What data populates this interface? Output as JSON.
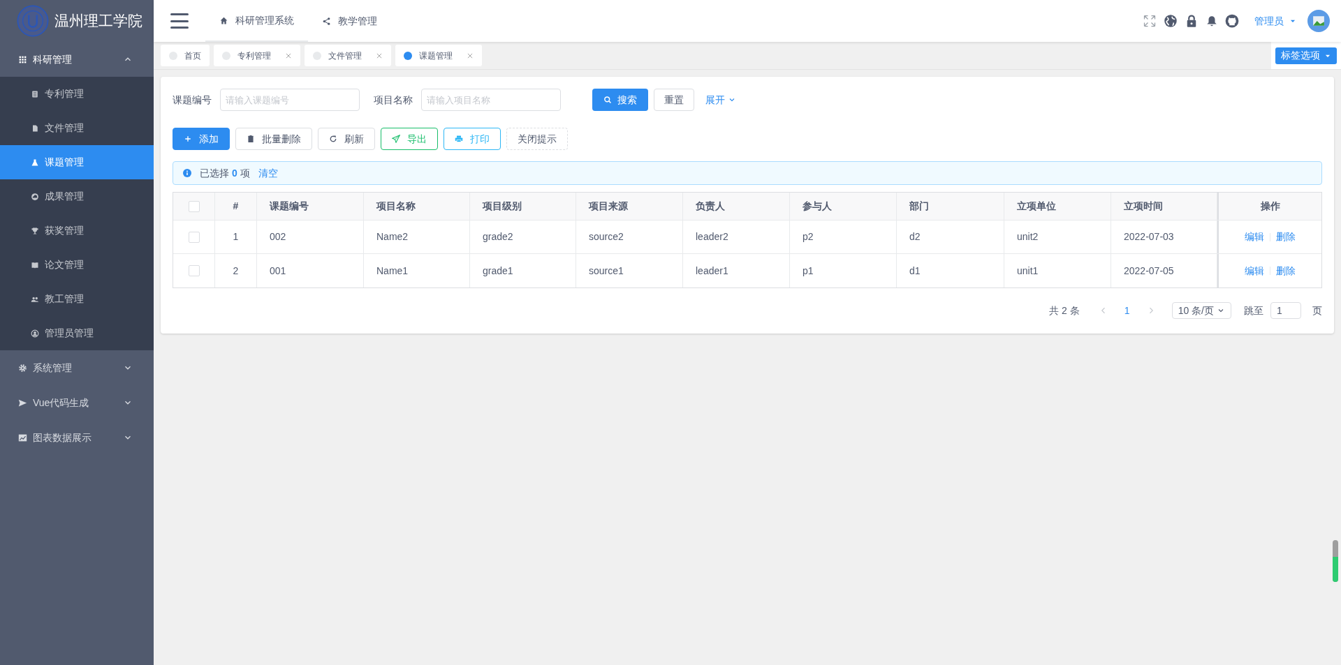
{
  "sidebar": {
    "brand": "温州理工学院",
    "menus": [
      {
        "label": "科研管理",
        "kind": "grid",
        "expanded": true,
        "children": [
          {
            "label": "专利管理",
            "kind": "doc",
            "selected": false
          },
          {
            "label": "文件管理",
            "kind": "file",
            "selected": false
          },
          {
            "label": "课题管理",
            "kind": "flask",
            "selected": true
          },
          {
            "label": "成果管理",
            "kind": "cloud",
            "selected": false
          },
          {
            "label": "获奖管理",
            "kind": "trophy",
            "selected": false
          },
          {
            "label": "论文管理",
            "kind": "book",
            "selected": false
          },
          {
            "label": "教工管理",
            "kind": "people",
            "selected": false
          },
          {
            "label": "管理员管理",
            "kind": "user",
            "selected": false
          }
        ]
      },
      {
        "label": "系统管理",
        "kind": "gear",
        "expanded": false
      },
      {
        "label": "Vue代码生成",
        "kind": "send",
        "expanded": false
      },
      {
        "label": "图表数据展示",
        "kind": "chart",
        "expanded": false
      }
    ]
  },
  "header": {
    "nav": [
      {
        "label": "科研管理系统",
        "kind": "home",
        "selected": true
      },
      {
        "label": "教学管理",
        "kind": "share",
        "selected": false
      }
    ],
    "user": "管理员"
  },
  "tabs": [
    {
      "label": "首页",
      "closable": false,
      "selected": false
    },
    {
      "label": "专利管理",
      "closable": true,
      "selected": false
    },
    {
      "label": "文件管理",
      "closable": true,
      "selected": false
    },
    {
      "label": "课题管理",
      "closable": true,
      "selected": true
    }
  ],
  "tab_options": "标签选项",
  "search": {
    "fields": [
      {
        "label": "课题编号",
        "placeholder": "请输入课题编号"
      },
      {
        "label": "项目名称",
        "placeholder": "请输入项目名称"
      }
    ],
    "search_button": "搜索",
    "reset_button": "重置",
    "expand_link": "展开"
  },
  "toolbar": [
    {
      "label": "添加",
      "kind": "primary"
    },
    {
      "label": "批量删除",
      "kind": "trash"
    },
    {
      "label": "刷新",
      "kind": "refresh"
    },
    {
      "label": "导出",
      "kind": "export"
    },
    {
      "label": "打印",
      "kind": "print"
    },
    {
      "label": "关闭提示",
      "kind": "dashed"
    }
  ],
  "alert": {
    "text": "已选择 **0** 项",
    "clear": "清空"
  },
  "table": {
    "all_checked": false,
    "columns": [
      "#",
      "课题编号",
      "项目名称",
      "项目级别",
      "项目来源",
      "负责人",
      "参与人",
      "部门",
      "立项单位",
      "立项时间",
      "操作"
    ],
    "rows": [
      {
        "checked": false,
        "cells": [
          "1",
          "002",
          "Name2",
          "grade2",
          "source2",
          "leader2",
          "p2",
          "d2",
          "unit2",
          "2022-07-03"
        ],
        "actions": [
          "编辑",
          "删除"
        ]
      },
      {
        "checked": false,
        "cells": [
          "2",
          "001",
          "Name1",
          "grade1",
          "source1",
          "leader1",
          "p1",
          "d1",
          "unit1",
          "2022-07-05"
        ],
        "actions": [
          "编辑",
          "删除"
        ]
      }
    ]
  },
  "pagination": {
    "total": "共 2 条",
    "pages": [
      {
        "label": "1",
        "selected": true
      }
    ],
    "page_size": "10 条/页",
    "jump_label": "跳至",
    "jump_value": "1",
    "page_unit": "页"
  },
  "side_meter": {
    "level": 0.6
  }
}
